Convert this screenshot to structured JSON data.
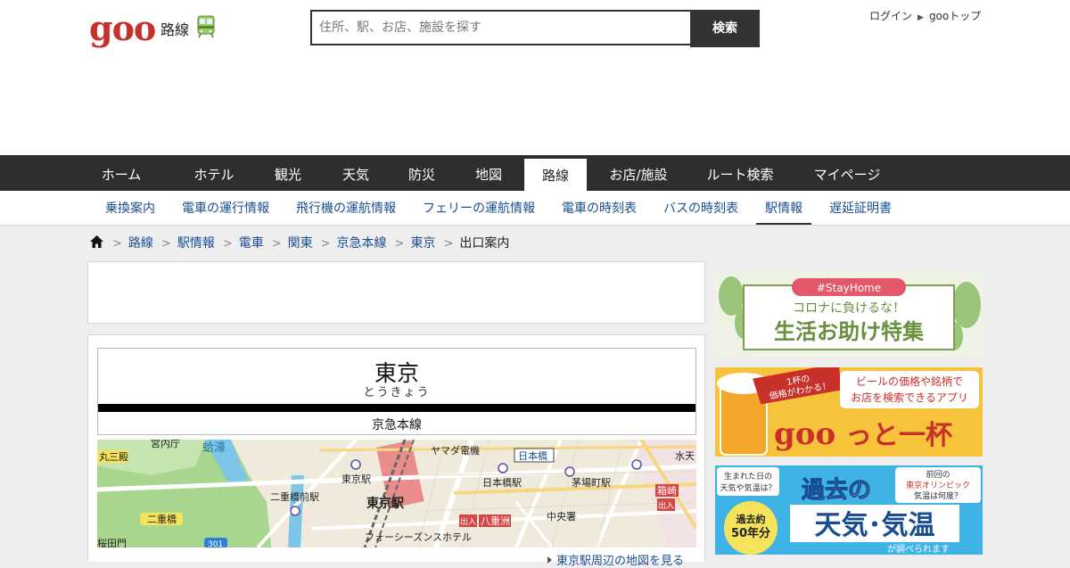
{
  "header": {
    "logo": "goo",
    "service_name": "路線",
    "search_placeholder": "住所、駅、お店、施設を探す",
    "search_button": "検索",
    "login": "ログイン",
    "goo_top": "gooトップ"
  },
  "global_nav": [
    "ホーム",
    "ホテル",
    "観光",
    "天気",
    "防災",
    "地図",
    "路線",
    "お店/施設",
    "ルート検索",
    "マイページ"
  ],
  "global_nav_active": "路線",
  "sub_nav": [
    "乗換案内",
    "電車の運行情報",
    "飛行機の運航情報",
    "フェリーの運航情報",
    "電車の時刻表",
    "バスの時刻表",
    "駅情報",
    "遅延証明書"
  ],
  "sub_nav_active": "駅情報",
  "breadcrumb": [
    "路線",
    "駅情報",
    "電車",
    "関東",
    "京急本線",
    "東京"
  ],
  "breadcrumb_current": "出口案内",
  "station": {
    "name": "東京",
    "kana": "とうきょう",
    "line": "京急本線"
  },
  "map": {
    "labels": [
      "宮内庁",
      "蛤濠",
      "丸三殿",
      "二重橋前駅",
      "二重橋",
      "桜田門",
      "東京駅",
      "東京駅",
      "ヤマダ電機",
      "日本橋",
      "日本橋駅",
      "茅場町駅",
      "中央署",
      "水天",
      "箱崎",
      "出入",
      "八重洲",
      "出入",
      "フォーシーズンスホテル",
      "301"
    ]
  },
  "map_link": "東京駅周辺の地図を見る",
  "banners": {
    "stayhome_tag": "#StayHome",
    "stayhome_line1": "コロナに負けるな！",
    "stayhome_line2": "生活お助け特集",
    "beer_badge_1": "1杯の",
    "beer_badge_2": "価格がわかる！",
    "beer_text_1": "ビールの価格や銘柄で",
    "beer_text_2": "お店を検索できるアプリ",
    "beer_logo_1": "goo",
    "beer_logo_2": "っと一杯",
    "weather_q1a": "生まれた日の",
    "weather_q1b": "天気や気温は？",
    "weather_q2a": "前回の",
    "weather_q2b": "東京オリンピック",
    "weather_q2c": "気温は何度？",
    "weather_title": "過去の",
    "weather_badge_1": "過去約",
    "weather_badge_2": "50年分",
    "weather_big": "天気･気温",
    "weather_foot": "が調べられます"
  },
  "colors": {
    "brand_red": "#c8302a",
    "nav_dark": "#2e2e2e",
    "link_blue": "#1a4e92"
  }
}
